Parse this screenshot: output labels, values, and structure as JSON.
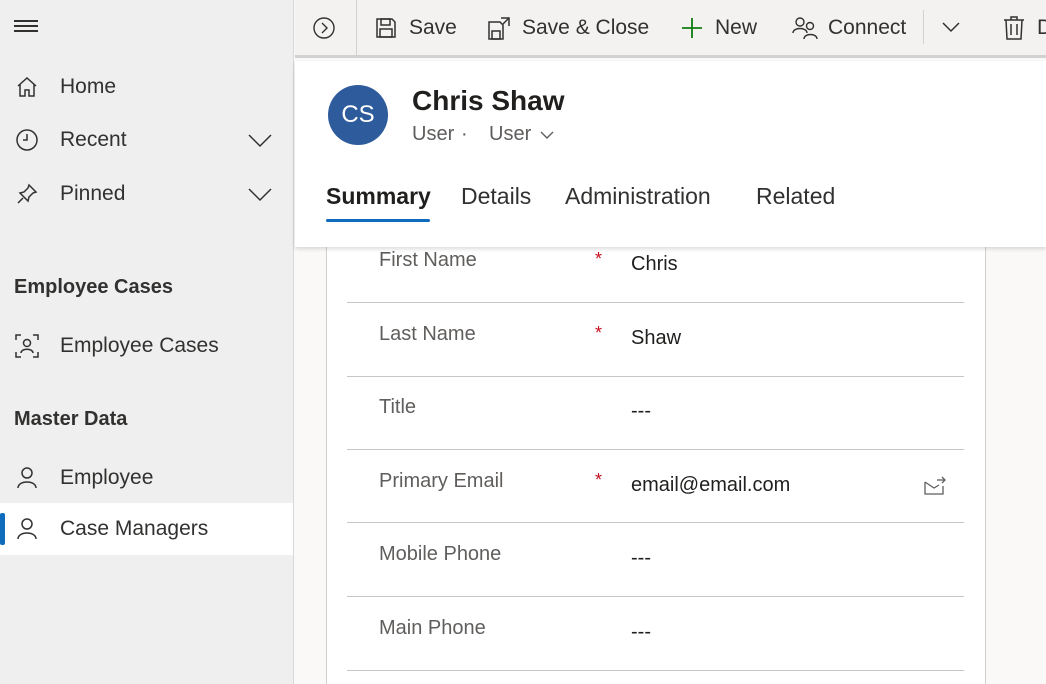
{
  "sidebar": {
    "items": [
      {
        "label": "Home",
        "icon": "home-icon"
      },
      {
        "label": "Recent",
        "icon": "clock-icon"
      },
      {
        "label": "Pinned",
        "icon": "pin-icon"
      }
    ],
    "sections": [
      {
        "title": "Employee Cases",
        "items": [
          {
            "label": "Employee Cases",
            "icon": "contact-card-icon"
          }
        ]
      },
      {
        "title": "Master Data",
        "items": [
          {
            "label": "Employee",
            "icon": "person-icon"
          },
          {
            "label": "Case Managers",
            "icon": "person-icon",
            "active": true
          }
        ]
      }
    ]
  },
  "toolbar": {
    "save": "Save",
    "save_close": "Save & Close",
    "new": "New",
    "connect": "Connect",
    "delete_partial": "D"
  },
  "record": {
    "initials": "CS",
    "name": "Chris Shaw",
    "entity": "User",
    "dot": "·",
    "form": "User",
    "avatar_color": "#2e5b9b"
  },
  "tabs": [
    "Summary",
    "Details",
    "Administration",
    "Related"
  ],
  "fields": [
    {
      "label": "First Name",
      "required": "*",
      "value": "Chris"
    },
    {
      "label": "Last Name",
      "required": "*",
      "value": "Shaw"
    },
    {
      "label": "Title",
      "required": "",
      "value": "---"
    },
    {
      "label": "Primary Email",
      "required": "*",
      "value": "email@email.com"
    },
    {
      "label": "Mobile Phone",
      "required": "",
      "value": "---"
    },
    {
      "label": "Main Phone",
      "required": "",
      "value": "---"
    }
  ],
  "colors": {
    "accent": "#0f6cbd",
    "required": "#c50f1f",
    "new_icon": "#107c10"
  }
}
